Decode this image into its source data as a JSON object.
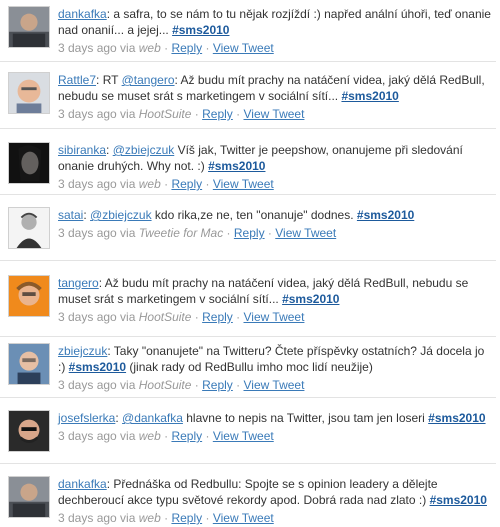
{
  "tweets": [
    {
      "user": "dankafka",
      "text": ": a safra, to se nám to tu nějak rozjíždí :) napřed anální úhoři, teď onanie nad onanií... a jejej... ",
      "hashtag": "#sms2010",
      "time": "3 days ago via",
      "source": "web",
      "reply": "Reply",
      "view": "View Tweet"
    },
    {
      "user": "Rattle7",
      "pre": ": RT ",
      "mention": "@tangero",
      "text": ": Až budu mít prachy na natáčení videa, jaký dělá RedBull, nebudu se muset srát s marketingem v sociální sítí... ",
      "hashtag": "#sms2010",
      "time": "3 days ago via",
      "source": "HootSuite",
      "reply": "Reply",
      "view": "View Tweet"
    },
    {
      "user": "sibiranka",
      "pre": ": ",
      "mention": "@zbiejczuk",
      "text": " Víš jak, Twitter je peepshow, onanujeme při sledování onanie druhých. Why not. :) ",
      "hashtag": "#sms2010",
      "time": "3 days ago via",
      "source": "web",
      "reply": "Reply",
      "view": "View Tweet"
    },
    {
      "user": "satai",
      "pre": ": ",
      "mention": "@zbiejczuk",
      "text": " kdo rika,ze ne, ten \"onanuje\" dodnes. ",
      "hashtag": "#sms2010",
      "time": "3 days ago via",
      "source": "Tweetie for Mac",
      "reply": "Reply",
      "view": "View Tweet"
    },
    {
      "user": "tangero",
      "text": ": Až budu mít prachy na natáčení videa, jaký dělá RedBull, nebudu se muset srát s marketingem v sociální sítí... ",
      "hashtag": "#sms2010",
      "time": "3 days ago via",
      "source": "HootSuite",
      "reply": "Reply",
      "view": "View Tweet"
    },
    {
      "user": "zbiejczuk",
      "text": ": Taky \"onanujete\" na Twitteru? Čtete příspěvky ostatních? Já docela jo :) ",
      "hashtag": "#sms2010",
      "post": " (jinak rady od RedBullu imho moc lidí neužije)",
      "time": "3 days ago via",
      "source": "HootSuite",
      "reply": "Reply",
      "view": "View Tweet"
    },
    {
      "user": "josefslerka",
      "pre": ": ",
      "mention": "@dankafka",
      "text": " hlavne to nepis na Twitter, jsou tam jen loseri ",
      "hashtag": "#sms2010",
      "time": "3 days ago via",
      "source": "web",
      "reply": "Reply",
      "view": "View Tweet"
    },
    {
      "user": "dankafka",
      "text": ": Přednáška od Redbullu: Spojte se s opinion leadery a dělejte dechberoucí akce typu světové rekordy apod. Dobrá rada nad zlato :) ",
      "hashtag": "#sms2010",
      "time": "3 days ago via",
      "source": "web",
      "reply": "Reply",
      "view": "View Tweet"
    }
  ],
  "sep": "·"
}
